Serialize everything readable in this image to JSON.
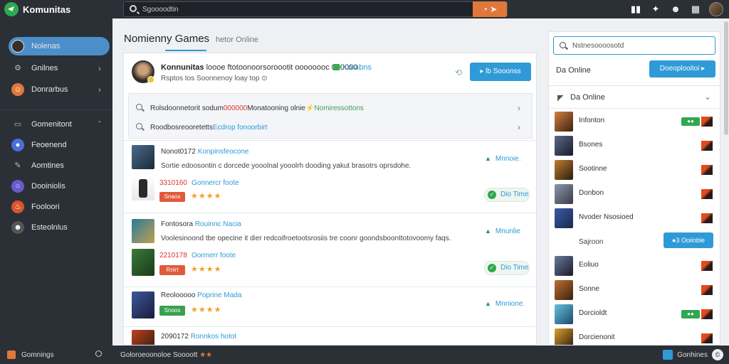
{
  "topbar": {
    "brand": "Komunitas",
    "search_value": "Sgoooodtin",
    "search_button_icon": "search-go-icon",
    "icons": [
      "book-icon",
      "bell-icon",
      "user-icon",
      "grid-icon"
    ]
  },
  "sidebar": {
    "items": [
      {
        "label": "Nolenas",
        "icon": "avatar-icon",
        "active": true
      },
      {
        "label": "Gnilnes",
        "icon": "gamepad-icon",
        "chevron": true
      },
      {
        "label": "Donrarbus",
        "icon": "users-icon",
        "chevron": true
      },
      {
        "label": "Gomenitont",
        "icon": "chat-icon",
        "chevron": true
      },
      {
        "label": "Feoenend",
        "icon": "globe-icon"
      },
      {
        "label": "Aomtines",
        "icon": "pen-icon"
      },
      {
        "label": "Dooiniolis",
        "icon": "circle-icon"
      },
      {
        "label": "Fooloori",
        "icon": "fire-icon"
      },
      {
        "label": "Esteolnlus",
        "icon": "group-icon"
      }
    ]
  },
  "main": {
    "title": "Nomienny Games",
    "tab2": "hetor Online",
    "post": {
      "author": "Konnunitas",
      "line1": "loooe ftotoonoorsoroootit oooooooc 000000",
      "badge": "Korabns",
      "line2": "Rsptos tos Soonnenoy loay top",
      "button": "▸ lb Sooonss"
    },
    "search_rows": [
      {
        "prefix": "Rolsdoonnetorit sodum ",
        "red": "000000",
        "mid": " Monatooning olnie ",
        "green": "Nomiressottons"
      },
      {
        "prefix": "Roodbosreooretetts ",
        "blue": "Ecdrop fonoorbirt"
      }
    ],
    "games": [
      {
        "code": "Nonot0172",
        "name": "Konpinsfeocone",
        "desc": "Sortie edoosontin c dorcede yooolnal yooolrh dooding yakut brasotrs oprsdohe.",
        "tag": "Mnnoie.",
        "price": "3310160",
        "price_link": "Gonnercr foote",
        "badge": "Snaos",
        "badge_color": "#e05a3c",
        "stars": "★★★★",
        "time": "Dio Time"
      },
      {
        "code": "Fontosora",
        "name": "Rouinnc Nacia",
        "desc": "Voolesinoond tbe opecine it dier redcoifroetootsrosiis tre coonr goondsboonttotovoomy faqs.",
        "tag": "Mnunlie",
        "price": "2210178",
        "price_link": "Oormerr foote",
        "badge": "Rnirt",
        "badge_color": "#e05a3c",
        "stars": "★★★★",
        "time": "Dio Time"
      },
      {
        "code": "Reolooooo",
        "name": "Poprine Mada",
        "desc": "",
        "tag": "Mnnione.",
        "price": "",
        "price_link": "",
        "badge": "Snoos",
        "badge_color": "#3aa04e",
        "stars": "★★★★",
        "time": ""
      },
      {
        "code": "2090172",
        "name": "Ronnkos hotot",
        "desc": "",
        "tag": "",
        "price": "",
        "price_link": "",
        "badge": "",
        "badge_color": "",
        "stars": "",
        "time": ""
      }
    ]
  },
  "right": {
    "search_value": "Nstnesoooosotd",
    "online_label": "Da Online",
    "online_button": "Doeoplooitoi ▸",
    "list_title": "Da Online",
    "friends": [
      {
        "name": "Infonton",
        "status": "on"
      },
      {
        "name": "Bsones",
        "status": ""
      },
      {
        "name": "Sootinne",
        "status": ""
      },
      {
        "name": "Donbon",
        "status": ""
      },
      {
        "name": "Nvoder Nsosioed",
        "status": ""
      }
    ],
    "sub_label": "Sajroon",
    "sub_button": "●3 Ooiinble",
    "friends2": [
      {
        "name": "Eoliuo",
        "status": ""
      },
      {
        "name": "Sonne",
        "status": ""
      },
      {
        "name": "Dorcioldt",
        "status": "on"
      },
      {
        "name": "Dorcienonit",
        "status": ""
      }
    ],
    "status_label": "●●"
  },
  "footer": {
    "left": "Gomnings",
    "mid": "Goloroeoonoloe Soooott",
    "mid_icons": "★★",
    "right": "Gonhines",
    "right_icon": "©"
  },
  "colors": {
    "accent": "#2f9ad7",
    "dark": "#2b2f36",
    "orange": "#e0783a",
    "green": "#2fa84f",
    "red": "#d9342b"
  }
}
